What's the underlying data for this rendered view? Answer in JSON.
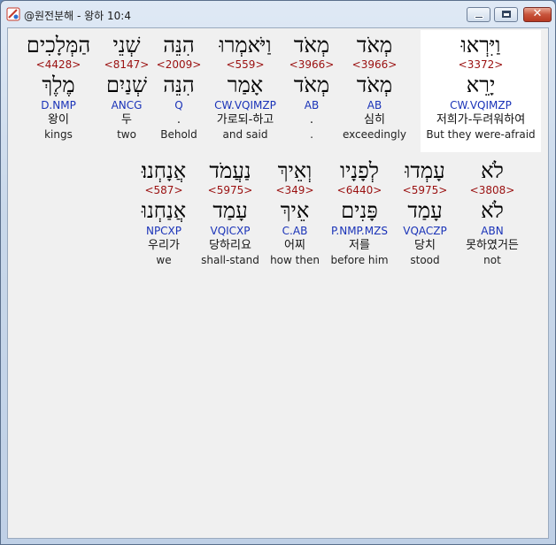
{
  "window": {
    "title": "@원전분해 - 왕하 10:4",
    "minimize_label": "",
    "maximize_label": "",
    "close_label": "✕"
  },
  "rows": [
    {
      "words": [
        {
          "heb": "וַיִּרְאוּ",
          "strong": "<3372>",
          "lemma": "יָרֵא",
          "morph": "CW.VQIMZP",
          "kor": "저희가-두려워하여",
          "eng": "But they were-afraid",
          "highlight": true
        },
        {
          "heb": "מְאֹד",
          "strong": "<3966>",
          "lemma": "מְאֹד",
          "morph": "AB",
          "kor": "심히",
          "eng": "exceedingly",
          "highlight": false
        },
        {
          "heb": "מְאֹד",
          "strong": "<3966>",
          "lemma": "מְאֹד",
          "morph": "AB",
          "kor": ".",
          "eng": ".",
          "highlight": false
        },
        {
          "heb": "וַיֹּאמְרוּ",
          "strong": "<559>",
          "lemma": "אָמַר",
          "morph": "CW.VQIMZP",
          "kor": "가로되-하고",
          "eng": "and said",
          "highlight": false
        },
        {
          "heb": "הִנֵּה",
          "strong": "<2009>",
          "lemma": "הִנֵּה",
          "morph": "Q",
          "kor": ".",
          "eng": "Behold",
          "highlight": false
        },
        {
          "heb": "שְׁנֵי",
          "strong": "<8147>",
          "lemma": "שְׁנַיִם",
          "morph": "ANCG",
          "kor": "두",
          "eng": "two",
          "highlight": false
        },
        {
          "heb": "הַמְּלָכִים",
          "strong": "<4428>",
          "lemma": "מֶלֶךְ",
          "morph": "D.NMP",
          "kor": "왕이",
          "eng": "kings",
          "highlight": false
        }
      ]
    },
    {
      "words": [
        {
          "heb": "לֹא",
          "strong": "<3808>",
          "lemma": "לֹא",
          "morph": "ABN",
          "kor": "못하였거든",
          "eng": "not",
          "highlight": false
        },
        {
          "heb": "עָמְדוּ",
          "strong": "<5975>",
          "lemma": "עָמַד",
          "morph": "VQACZP",
          "kor": "당치",
          "eng": "stood",
          "highlight": false
        },
        {
          "heb": "לְפָנָיו",
          "strong": "<6440>",
          "lemma": "פָּנִים",
          "morph": "P.NMP.MZS",
          "kor": "저를",
          "eng": "before him",
          "highlight": false
        },
        {
          "heb": "וְאֵיךְ",
          "strong": "<349>",
          "lemma": "אֵיךְ",
          "morph": "C.AB",
          "kor": "어찌",
          "eng": "how then",
          "highlight": false
        },
        {
          "heb": "נַעֲמֹד",
          "strong": "<5975>",
          "lemma": "עָמַד",
          "morph": "VQICXP",
          "kor": "당하리요",
          "eng": "shall-stand",
          "highlight": false
        },
        {
          "heb": "אֲנָחְנוּ׃",
          "strong": "<587>",
          "lemma": "אֲנַחְנוּ",
          "morph": "NPCXP",
          "kor": "우리가",
          "eng": "we",
          "highlight": false
        }
      ]
    }
  ]
}
